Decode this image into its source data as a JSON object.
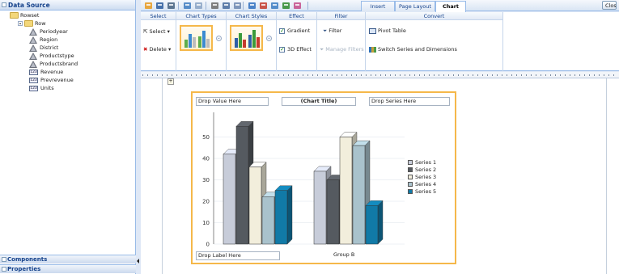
{
  "left_panel": {
    "title": "Data Source",
    "tree": [
      {
        "label": "Rowset",
        "kind": "folder",
        "depth": 0
      },
      {
        "label": "Row",
        "kind": "folder",
        "depth": 1
      },
      {
        "label": "Periodyear",
        "kind": "dimension",
        "depth": 2
      },
      {
        "label": "Region",
        "kind": "dimension",
        "depth": 2
      },
      {
        "label": "District",
        "kind": "dimension",
        "depth": 2
      },
      {
        "label": "Productstype",
        "kind": "dimension",
        "depth": 2
      },
      {
        "label": "Productsbrand",
        "kind": "dimension",
        "depth": 2
      },
      {
        "label": "Revenue",
        "kind": "measure",
        "depth": 2
      },
      {
        "label": "Prevrevenue",
        "kind": "measure",
        "depth": 2
      },
      {
        "label": "Units",
        "kind": "measure",
        "depth": 2
      }
    ],
    "measure_icon_text": "123",
    "components_label": "Components",
    "properties_label": "Properties"
  },
  "toolbar": {
    "tabs": [
      "Insert",
      "Page Layout",
      "Chart"
    ],
    "active_tab": "Chart",
    "close_label": "Close",
    "icons": [
      "new-icon",
      "save-icon",
      "save-as-icon",
      "undo-icon",
      "redo-icon",
      "cut-icon",
      "copy-icon",
      "paste-icon",
      "preview-icon",
      "pdf-icon",
      "html-icon",
      "excel-icon",
      "rtf-icon"
    ]
  },
  "ribbon": {
    "select": {
      "title": "Select",
      "select_label": "Select ▾",
      "delete_label": "Delete ▾"
    },
    "chart_types": {
      "title": "Chart Types"
    },
    "chart_styles": {
      "title": "Chart Styles"
    },
    "effect": {
      "title": "Effect",
      "gradient_label": "Gradient",
      "effect3d_label": "3D Effect"
    },
    "filter": {
      "title": "Filter",
      "filter_label": "Filter",
      "manage_label": "Manage Filters"
    },
    "convert": {
      "title": "Convert",
      "pivot_label": "Pivot Table",
      "switch_label": "Switch Series and Dimensions"
    }
  },
  "chart": {
    "drop_value": "Drop Value Here",
    "chart_title": "(Chart Title)",
    "drop_series": "Drop Series Here",
    "drop_label": "Drop Label Here",
    "group_label": "Group B"
  },
  "chart_data": {
    "type": "bar",
    "title": "(Chart Title)",
    "categories": [
      "",
      "Group B"
    ],
    "ylim": [
      0,
      60
    ],
    "yticks": [
      0,
      10,
      20,
      30,
      40,
      50
    ],
    "grid": true,
    "legend_position": "right",
    "series": [
      {
        "name": "Series 1",
        "color": "#c7ccd9",
        "values": [
          42,
          34
        ]
      },
      {
        "name": "Series 2",
        "color": "#555a60",
        "values": [
          55,
          30
        ]
      },
      {
        "name": "Series 3",
        "color": "#f2eedc",
        "values": [
          36,
          50
        ]
      },
      {
        "name": "Series 4",
        "color": "#a9c2cc",
        "values": [
          22,
          46
        ]
      },
      {
        "name": "Series 5",
        "color": "#117aa7",
        "values": [
          25,
          18
        ]
      }
    ]
  },
  "colors": {
    "accent": "#f5b84a",
    "panel_border": "#99bbe8",
    "header_text": "#15428b"
  }
}
